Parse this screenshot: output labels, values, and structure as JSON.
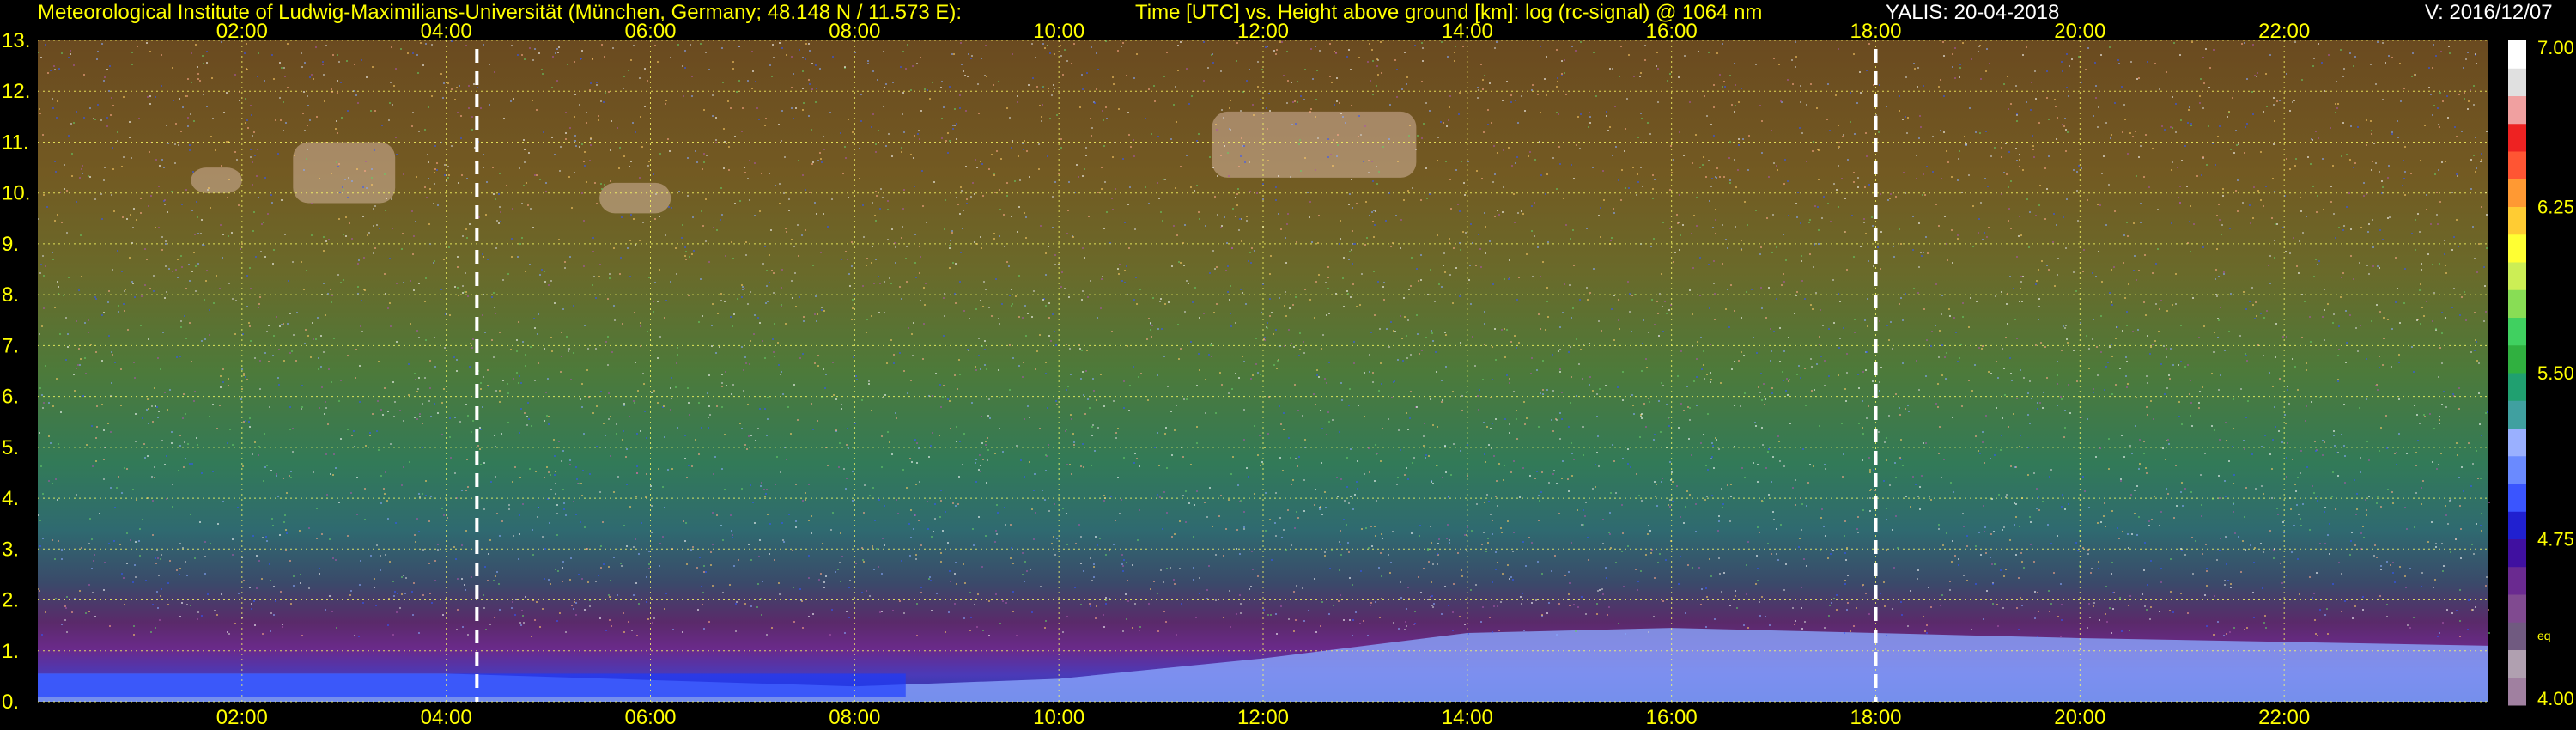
{
  "header": {
    "institute": "Meteorological Institute of Ludwig-Maximilians-Universität (München, Germany; 48.148 N / 11.573 E):",
    "axes_description": "Time [UTC] vs. Height above ground [km]: log (rc-signal) @ 1064 nm",
    "instrument_date": "YALIS: 20-04-2018",
    "version": "V: 2016/12/07"
  },
  "chart_data": {
    "type": "heatmap",
    "title": "Time [UTC] vs. Height above ground [km]: log (rc-signal) @ 1064 nm",
    "xlim_hours": [
      0,
      24
    ],
    "ylim_km": [
      0,
      13
    ],
    "x_ticks": [
      {
        "hour": 2,
        "label": "02:00"
      },
      {
        "hour": 4,
        "label": "04:00"
      },
      {
        "hour": 6,
        "label": "06:00"
      },
      {
        "hour": 8,
        "label": "08:00"
      },
      {
        "hour": 10,
        "label": "10:00"
      },
      {
        "hour": 12,
        "label": "12:00"
      },
      {
        "hour": 14,
        "label": "14:00"
      },
      {
        "hour": 16,
        "label": "16:00"
      },
      {
        "hour": 18,
        "label": "18:00"
      },
      {
        "hour": 20,
        "label": "20:00"
      },
      {
        "hour": 22,
        "label": "22:00"
      }
    ],
    "y_ticks": [
      "0.",
      "1.",
      "2.",
      "3.",
      "4.",
      "5.",
      "6.",
      "7.",
      "8.",
      "9.",
      "10.",
      "11.",
      "12.",
      "13."
    ],
    "grid": true,
    "markers_hours": [
      4.3,
      18.0
    ],
    "colorbar": {
      "range": [
        4.0,
        7.0
      ],
      "labels": [
        "4.00",
        "4.75",
        "5.50",
        "6.25",
        "7.00"
      ],
      "note": "eq"
    },
    "features": {
      "boundary_layer_top_km": [
        {
          "hour": 0.0,
          "km": 0.55
        },
        {
          "hour": 4.0,
          "km": 0.55
        },
        {
          "hour": 8.0,
          "km": 0.3
        },
        {
          "hour": 10.0,
          "km": 0.45
        },
        {
          "hour": 12.0,
          "km": 0.85
        },
        {
          "hour": 14.0,
          "km": 1.35
        },
        {
          "hour": 16.0,
          "km": 1.45
        },
        {
          "hour": 18.0,
          "km": 1.35
        },
        {
          "hour": 20.0,
          "km": 1.25
        },
        {
          "hour": 24.0,
          "km": 1.1
        }
      ],
      "cirrus": [
        {
          "hour_start": 2.5,
          "hour_end": 3.5,
          "km_bottom": 9.8,
          "km_top": 11.0
        },
        {
          "hour_start": 1.5,
          "hour_end": 2.0,
          "km_bottom": 10.0,
          "km_top": 10.5
        },
        {
          "hour_start": 11.5,
          "hour_end": 13.5,
          "km_bottom": 10.3,
          "km_top": 11.6
        },
        {
          "hour_start": 5.5,
          "hour_end": 6.2,
          "km_bottom": 9.6,
          "km_top": 10.2
        }
      ]
    }
  }
}
